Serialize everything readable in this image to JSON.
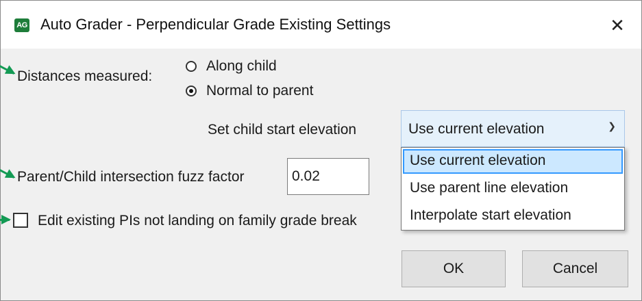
{
  "window": {
    "icon_text": "AG",
    "title": "Auto Grader - Perpendicular Grade Existing Settings",
    "close_glyph": "✕"
  },
  "distances": {
    "label": "Distances measured:",
    "options": [
      {
        "label": "Along child",
        "selected": false
      },
      {
        "label": "Normal to parent",
        "selected": true
      }
    ]
  },
  "child_start": {
    "label": "Set child start elevation",
    "selected_value": "Use current elevation",
    "chevron": "⌄",
    "options": [
      {
        "label": "Use current elevation",
        "highlighted": true
      },
      {
        "label": "Use parent line elevation",
        "highlighted": false
      },
      {
        "label": "Interpolate start elevation",
        "highlighted": false
      }
    ]
  },
  "fuzz": {
    "label": "Parent/Child intersection fuzz factor",
    "value": "0.02"
  },
  "edit_pis": {
    "label": "Edit existing PIs not landing on family grade break",
    "checked": false
  },
  "buttons": {
    "ok": "OK",
    "cancel": "Cancel"
  },
  "colors": {
    "annotation_arrow": "#139a54",
    "dropdown_highlight": "#cce8ff",
    "dropdown_highlight_border": "#3399ff",
    "app_icon": "#1e7d3a"
  }
}
